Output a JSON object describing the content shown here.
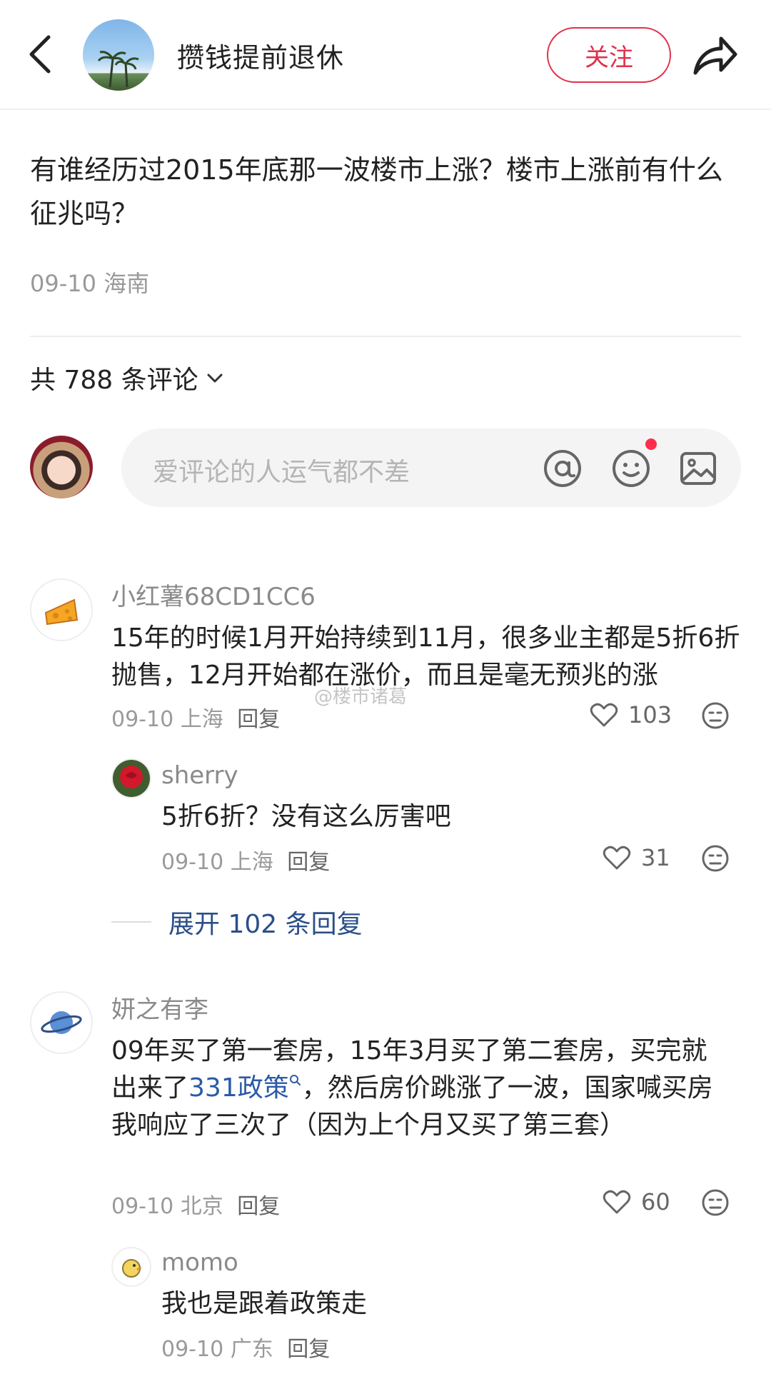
{
  "header": {
    "title": "攒钱提前退休",
    "follow_label": "关注"
  },
  "post": {
    "title": "有谁经历过2015年底那一波楼市上涨？楼市上涨前有什么征兆吗？",
    "date": "09-10",
    "location": "海南"
  },
  "comments_header": {
    "label": "共 788 条评论"
  },
  "input": {
    "placeholder": "爱评论的人运气都不差"
  },
  "comments": [
    {
      "author": "小红薯68CD1CC6",
      "text": "15年的时候1月开始持续到11月，很多业主都是5折6折抛售，12月开始都在涨价，而且是毫无预兆的涨",
      "date": "09-10",
      "location": "上海",
      "reply_label": "回复",
      "likes": "103",
      "replies": [
        {
          "author": "sherry",
          "text": "5折6折？没有这么厉害吧",
          "date": "09-10",
          "location": "上海",
          "reply_label": "回复",
          "likes": "31"
        }
      ],
      "expand_label": "展开 102 条回复"
    },
    {
      "author": "妍之有李",
      "text_before": "09年买了第一套房，15年3月买了第二套房，买完就出来了",
      "link_text": "331政策",
      "text_after": "，然后房价跳涨了一波，国家喊买房我响应了三次了（因为上个月又买了第三套）",
      "date": "09-10",
      "location": "北京",
      "reply_label": "回复",
      "likes": "60",
      "replies": [
        {
          "author": "momo",
          "text": "我也是跟着政策走",
          "date": "09-10",
          "location": "广东",
          "reply_label": "回复"
        }
      ]
    }
  ],
  "watermark": "@楼市诸葛",
  "colors": {
    "accent": "#e0314b",
    "link": "#2b5aa8",
    "muted": "#999999"
  }
}
